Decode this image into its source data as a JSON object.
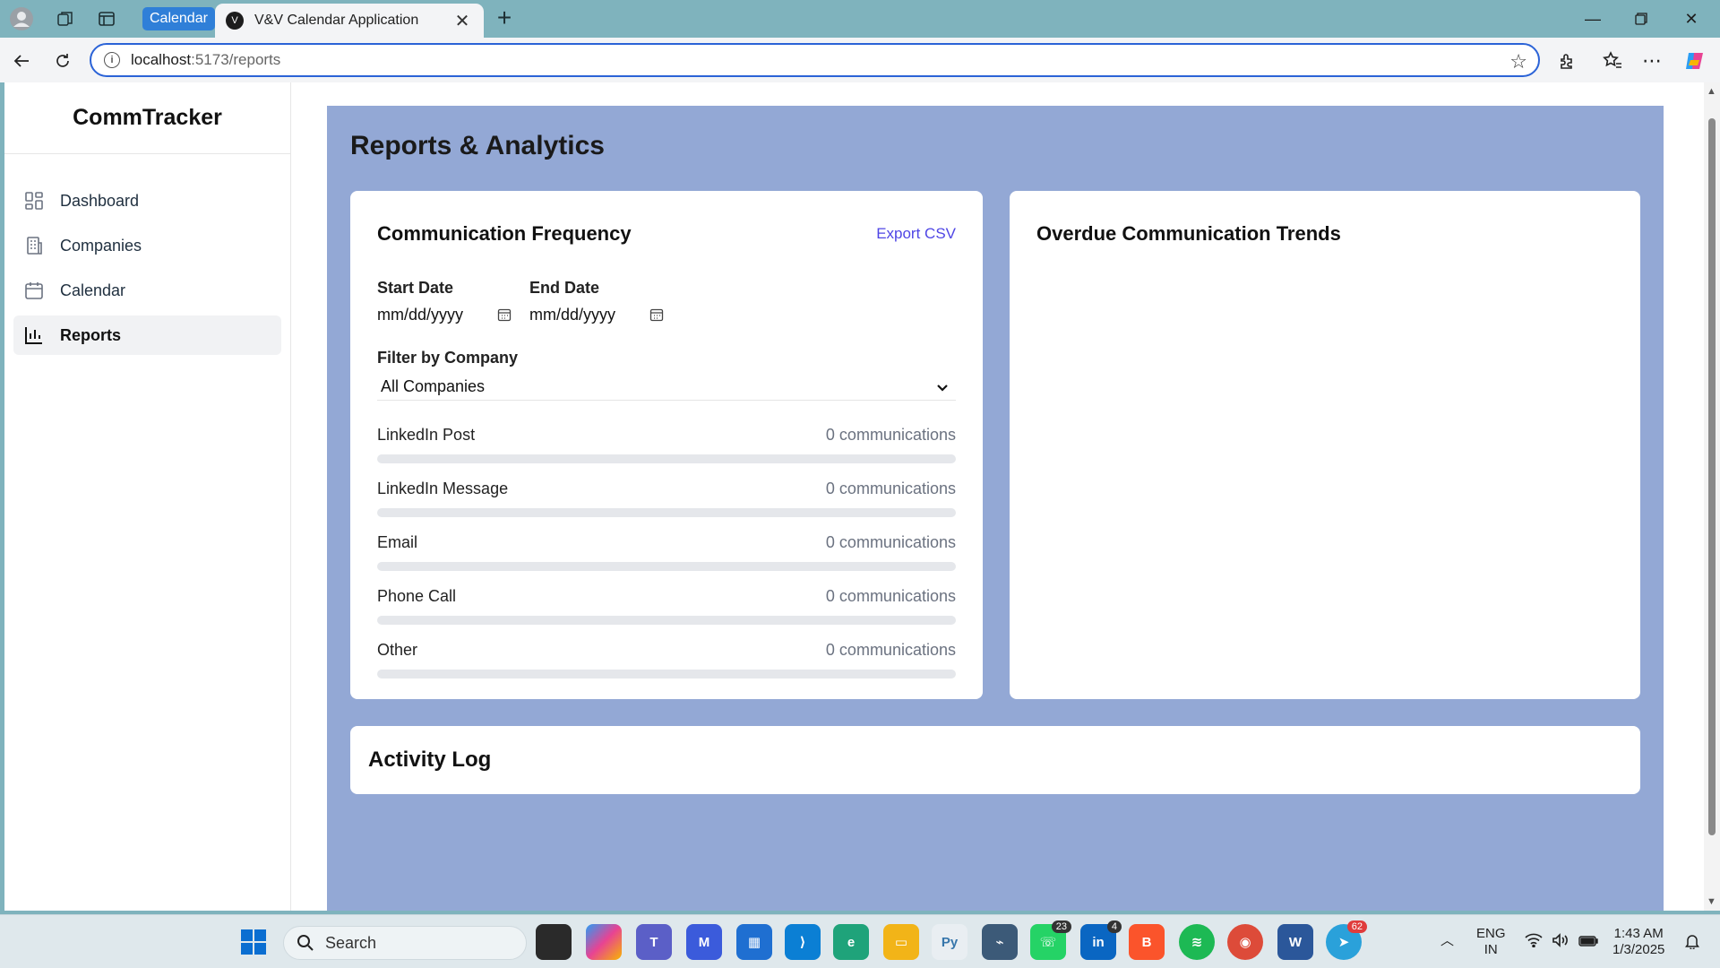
{
  "browser": {
    "tab_group_label": "Calendar",
    "tab_title": "V&V Calendar Application",
    "url_host": "localhost",
    "url_path": ":5173/reports"
  },
  "sidebar": {
    "brand": "CommTracker",
    "items": [
      {
        "label": "Dashboard",
        "icon": "dashboard-icon",
        "active": false
      },
      {
        "label": "Companies",
        "icon": "building-icon",
        "active": false
      },
      {
        "label": "Calendar",
        "icon": "calendar-icon",
        "active": false
      },
      {
        "label": "Reports",
        "icon": "bar-chart-icon",
        "active": true
      }
    ]
  },
  "main": {
    "title": "Reports & Analytics",
    "frequency_card": {
      "title": "Communication Frequency",
      "export_label": "Export CSV",
      "start_date_label": "Start Date",
      "start_date_placeholder": "mm/dd/yyyy",
      "end_date_label": "End Date",
      "end_date_placeholder": "mm/dd/yyyy",
      "filter_label": "Filter by Company",
      "filter_value": "All Companies",
      "metrics": [
        {
          "name": "LinkedIn Post",
          "count": "0 communications",
          "fraction": 0
        },
        {
          "name": "LinkedIn Message",
          "count": "0 communications",
          "fraction": 0
        },
        {
          "name": "Email",
          "count": "0 communications",
          "fraction": 0
        },
        {
          "name": "Phone Call",
          "count": "0 communications",
          "fraction": 0
        },
        {
          "name": "Other",
          "count": "0 communications",
          "fraction": 0
        }
      ]
    },
    "overdue_card": {
      "title": "Overdue Communication Trends"
    },
    "activity_log": {
      "title": "Activity Log"
    }
  },
  "taskbar": {
    "search_placeholder": "Search",
    "badges": {
      "whatsapp": "23",
      "linkedin": "4",
      "telegram": "62"
    },
    "language_top": "ENG",
    "language_bottom": "IN",
    "time": "1:43 AM",
    "date": "1/3/2025"
  },
  "colors": {
    "accent": "#4f46e5",
    "main_bg": "#93a8d5",
    "tab_strip": "#7fb3bd"
  }
}
